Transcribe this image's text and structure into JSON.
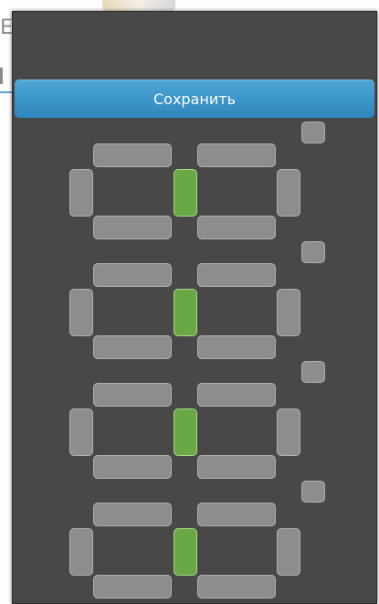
{
  "background": {
    "visible_letter": "E"
  },
  "dialog": {
    "save_label": "Сохранить",
    "colors": {
      "panel": "#484848",
      "segment_off": "#8d8d8d",
      "segment_on": "#6aa845",
      "button": "#3e97ca"
    },
    "digits": [
      {
        "segments_on": [
          "middle-vertical"
        ],
        "toggle_on": false
      },
      {
        "segments_on": [
          "middle-vertical"
        ],
        "toggle_on": false
      },
      {
        "segments_on": [
          "middle-vertical"
        ],
        "toggle_on": false
      },
      {
        "segments_on": [
          "middle-vertical"
        ],
        "toggle_on": false
      }
    ]
  }
}
